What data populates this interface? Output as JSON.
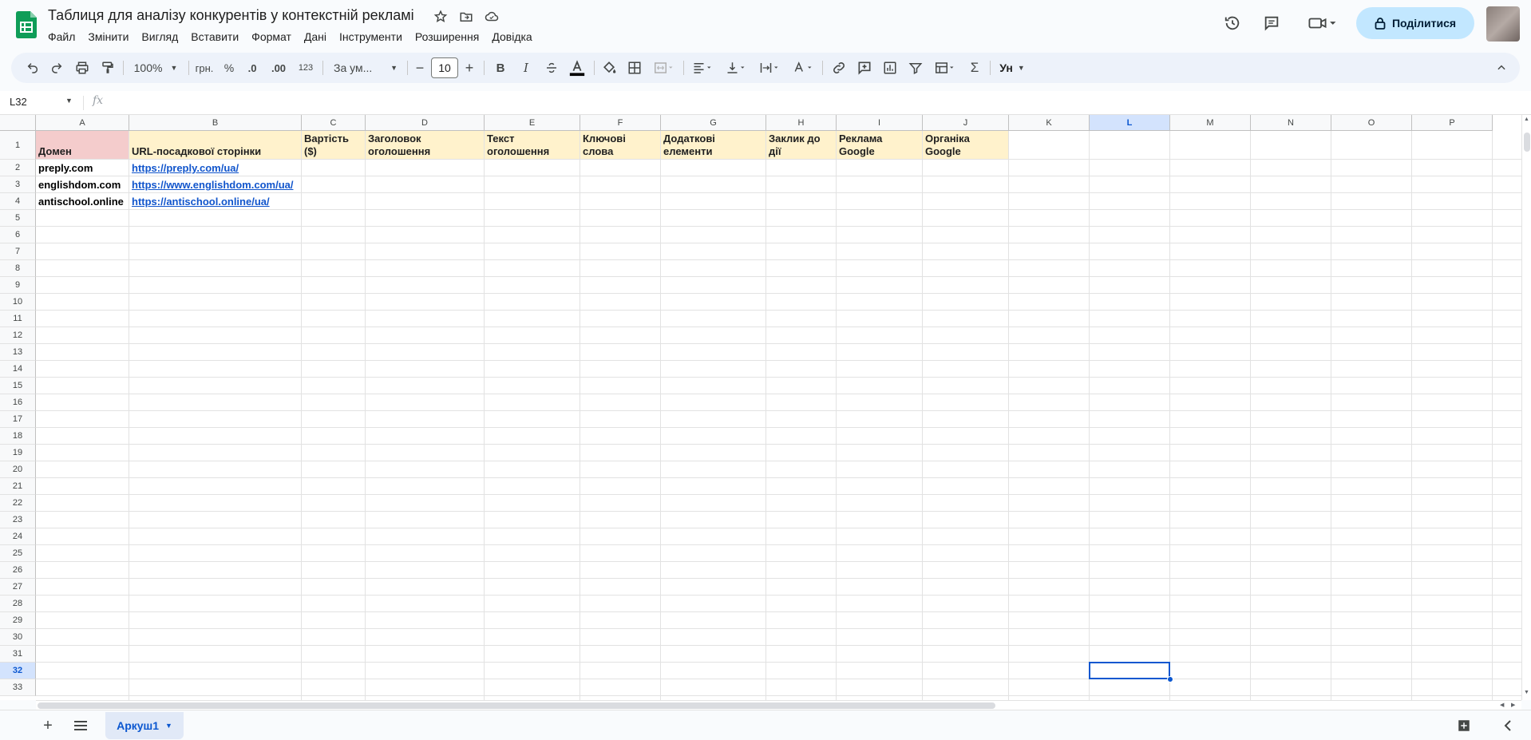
{
  "document": {
    "title": "Таблиця для аналізу конкурентів у контекстній рекламі"
  },
  "menu": [
    "Файл",
    "Змінити",
    "Вигляд",
    "Вставити",
    "Формат",
    "Дані",
    "Інструменти",
    "Розширення",
    "Довідка"
  ],
  "header": {
    "share_label": "Поділитися"
  },
  "toolbar": {
    "zoom": "100%",
    "currency": "грн.",
    "percent": "%",
    "decrease_decimal": ".0",
    "increase_decimal": ".00",
    "number_format": "123",
    "font": "За ум...",
    "font_size": "10",
    "bold": "B",
    "italic": "I",
    "sigma": "Σ",
    "input_tools": "Ун"
  },
  "formula_bar": {
    "name_box": "L32",
    "fx": "fx"
  },
  "grid": {
    "columns": [
      "A",
      "B",
      "C",
      "D",
      "E",
      "F",
      "G",
      "H",
      "I",
      "J",
      "K",
      "L",
      "M",
      "N",
      "O",
      "P"
    ],
    "selected_column": "L",
    "rows": [
      "1",
      "2",
      "3",
      "4",
      "5",
      "6",
      "7",
      "8",
      "9",
      "10",
      "11",
      "12",
      "13",
      "14",
      "15",
      "16",
      "17",
      "18",
      "19",
      "20",
      "21",
      "22",
      "23",
      "24",
      "25",
      "26",
      "27",
      "28",
      "29",
      "30",
      "31",
      "32",
      "33"
    ],
    "selected_row": "32",
    "header_row": [
      "Домен",
      "URL-посадкової сторінки",
      "Вартість ($)",
      "Заголовок оголошення",
      "Текст оголошення",
      "Ключові слова",
      "Додаткові елементи",
      "Заклик до дії",
      "Реклама Google",
      "Органіка Google"
    ],
    "data_rows": [
      {
        "domain": "preply.com",
        "url": "https://preply.com/ua/"
      },
      {
        "domain": "englishdom.com",
        "url": "https://www.englishdom.com/ua/"
      },
      {
        "domain": "antischool.online",
        "url": "https://antischool.online/ua/"
      }
    ]
  },
  "sheets": {
    "active_tab": "Аркуш1"
  },
  "colors": {
    "header_yellow": "#fff2cc",
    "header_pink": "#f4cccc",
    "accent": "#0b57d0",
    "share_bg": "#c2e7ff"
  }
}
